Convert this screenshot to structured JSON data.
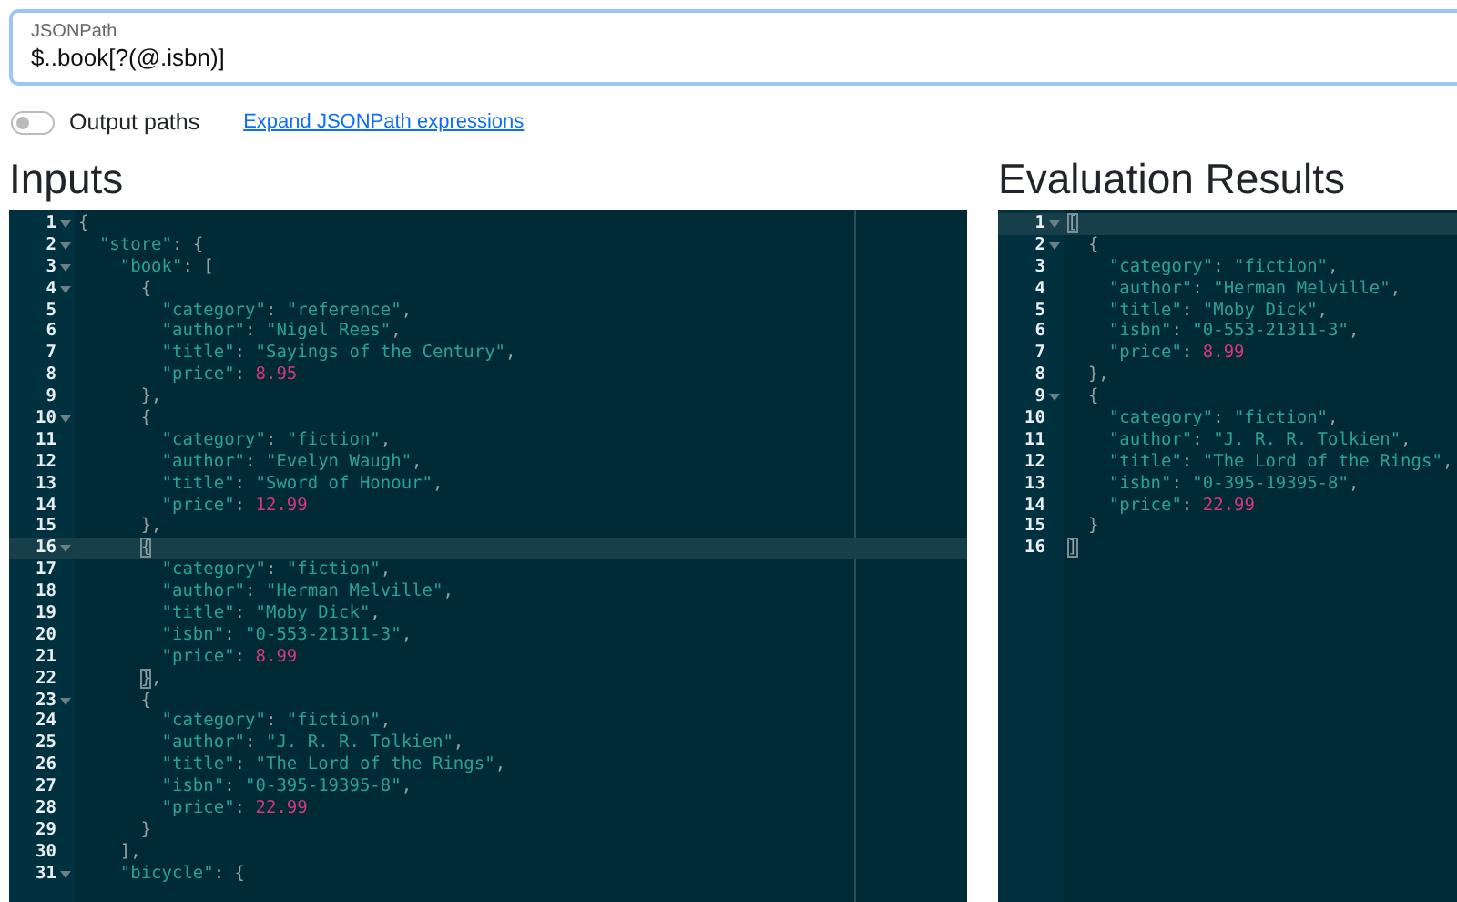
{
  "query": {
    "label": "JSONPath",
    "value": "$..book[?(@.isbn)]"
  },
  "options": {
    "toggle": {
      "label": "Output paths",
      "on": false
    },
    "link": "Expand JSONPath expressions"
  },
  "inputs": {
    "heading": "Inputs",
    "lines": [
      {
        "number": "1",
        "foldable": true,
        "active": false,
        "tokens": [
          {
            "kind": "punct",
            "text": "{"
          }
        ]
      },
      {
        "number": "2",
        "foldable": true,
        "active": false,
        "tokens": [
          {
            "kind": "string",
            "text": "  \"store\""
          },
          {
            "kind": "punct",
            "text": ": {"
          }
        ]
      },
      {
        "number": "3",
        "foldable": true,
        "active": false,
        "tokens": [
          {
            "kind": "string",
            "text": "    \"book\""
          },
          {
            "kind": "punct",
            "text": ": ["
          }
        ]
      },
      {
        "number": "4",
        "foldable": true,
        "active": false,
        "tokens": [
          {
            "kind": "punct",
            "text": "      {"
          }
        ]
      },
      {
        "number": "5",
        "foldable": false,
        "active": false,
        "tokens": [
          {
            "kind": "string",
            "text": "        \"category\""
          },
          {
            "kind": "punct",
            "text": ": "
          },
          {
            "kind": "string",
            "text": "\"reference\""
          },
          {
            "kind": "punct",
            "text": ","
          }
        ]
      },
      {
        "number": "6",
        "foldable": false,
        "active": false,
        "tokens": [
          {
            "kind": "string",
            "text": "        \"author\""
          },
          {
            "kind": "punct",
            "text": ": "
          },
          {
            "kind": "string",
            "text": "\"Nigel Rees\""
          },
          {
            "kind": "punct",
            "text": ","
          }
        ]
      },
      {
        "number": "7",
        "foldable": false,
        "active": false,
        "tokens": [
          {
            "kind": "string",
            "text": "        \"title\""
          },
          {
            "kind": "punct",
            "text": ": "
          },
          {
            "kind": "string",
            "text": "\"Sayings of the Century\""
          },
          {
            "kind": "punct",
            "text": ","
          }
        ]
      },
      {
        "number": "8",
        "foldable": false,
        "active": false,
        "tokens": [
          {
            "kind": "string",
            "text": "        \"price\""
          },
          {
            "kind": "punct",
            "text": ": "
          },
          {
            "kind": "number",
            "text": "8.95"
          }
        ]
      },
      {
        "number": "9",
        "foldable": false,
        "active": false,
        "tokens": [
          {
            "kind": "punct",
            "text": "      },"
          }
        ]
      },
      {
        "number": "10",
        "foldable": true,
        "active": false,
        "tokens": [
          {
            "kind": "punct",
            "text": "      {"
          }
        ]
      },
      {
        "number": "11",
        "foldable": false,
        "active": false,
        "tokens": [
          {
            "kind": "string",
            "text": "        \"category\""
          },
          {
            "kind": "punct",
            "text": ": "
          },
          {
            "kind": "string",
            "text": "\"fiction\""
          },
          {
            "kind": "punct",
            "text": ","
          }
        ]
      },
      {
        "number": "12",
        "foldable": false,
        "active": false,
        "tokens": [
          {
            "kind": "string",
            "text": "        \"author\""
          },
          {
            "kind": "punct",
            "text": ": "
          },
          {
            "kind": "string",
            "text": "\"Evelyn Waugh\""
          },
          {
            "kind": "punct",
            "text": ","
          }
        ]
      },
      {
        "number": "13",
        "foldable": false,
        "active": false,
        "tokens": [
          {
            "kind": "string",
            "text": "        \"title\""
          },
          {
            "kind": "punct",
            "text": ": "
          },
          {
            "kind": "string",
            "text": "\"Sword of Honour\""
          },
          {
            "kind": "punct",
            "text": ","
          }
        ]
      },
      {
        "number": "14",
        "foldable": false,
        "active": false,
        "tokens": [
          {
            "kind": "string",
            "text": "        \"price\""
          },
          {
            "kind": "punct",
            "text": ": "
          },
          {
            "kind": "number",
            "text": "12.99"
          }
        ]
      },
      {
        "number": "15",
        "foldable": false,
        "active": false,
        "tokens": [
          {
            "kind": "punct",
            "text": "      },"
          }
        ]
      },
      {
        "number": "16",
        "foldable": true,
        "active": true,
        "tokens": [
          {
            "kind": "matched",
            "text": "      {"
          }
        ]
      },
      {
        "number": "17",
        "foldable": false,
        "active": false,
        "tokens": [
          {
            "kind": "string",
            "text": "        \"category\""
          },
          {
            "kind": "punct",
            "text": ": "
          },
          {
            "kind": "string",
            "text": "\"fiction\""
          },
          {
            "kind": "punct",
            "text": ","
          }
        ]
      },
      {
        "number": "18",
        "foldable": false,
        "active": false,
        "tokens": [
          {
            "kind": "string",
            "text": "        \"author\""
          },
          {
            "kind": "punct",
            "text": ": "
          },
          {
            "kind": "string",
            "text": "\"Herman Melville\""
          },
          {
            "kind": "punct",
            "text": ","
          }
        ]
      },
      {
        "number": "19",
        "foldable": false,
        "active": false,
        "tokens": [
          {
            "kind": "string",
            "text": "        \"title\""
          },
          {
            "kind": "punct",
            "text": ": "
          },
          {
            "kind": "string",
            "text": "\"Moby Dick\""
          },
          {
            "kind": "punct",
            "text": ","
          }
        ]
      },
      {
        "number": "20",
        "foldable": false,
        "active": false,
        "tokens": [
          {
            "kind": "string",
            "text": "        \"isbn\""
          },
          {
            "kind": "punct",
            "text": ": "
          },
          {
            "kind": "string",
            "text": "\"0-553-21311-3\""
          },
          {
            "kind": "punct",
            "text": ","
          }
        ]
      },
      {
        "number": "21",
        "foldable": false,
        "active": false,
        "tokens": [
          {
            "kind": "string",
            "text": "        \"price\""
          },
          {
            "kind": "punct",
            "text": ": "
          },
          {
            "kind": "number",
            "text": "8.99"
          }
        ]
      },
      {
        "number": "22",
        "foldable": false,
        "active": false,
        "tokens": [
          {
            "kind": "matched",
            "text": "      }"
          },
          {
            "kind": "punct",
            "text": ","
          }
        ]
      },
      {
        "number": "23",
        "foldable": true,
        "active": false,
        "tokens": [
          {
            "kind": "punct",
            "text": "      {"
          }
        ]
      },
      {
        "number": "24",
        "foldable": false,
        "active": false,
        "tokens": [
          {
            "kind": "string",
            "text": "        \"category\""
          },
          {
            "kind": "punct",
            "text": ": "
          },
          {
            "kind": "string",
            "text": "\"fiction\""
          },
          {
            "kind": "punct",
            "text": ","
          }
        ]
      },
      {
        "number": "25",
        "foldable": false,
        "active": false,
        "tokens": [
          {
            "kind": "string",
            "text": "        \"author\""
          },
          {
            "kind": "punct",
            "text": ": "
          },
          {
            "kind": "string",
            "text": "\"J. R. R. Tolkien\""
          },
          {
            "kind": "punct",
            "text": ","
          }
        ]
      },
      {
        "number": "26",
        "foldable": false,
        "active": false,
        "tokens": [
          {
            "kind": "string",
            "text": "        \"title\""
          },
          {
            "kind": "punct",
            "text": ": "
          },
          {
            "kind": "string",
            "text": "\"The Lord of the Rings\""
          },
          {
            "kind": "punct",
            "text": ","
          }
        ]
      },
      {
        "number": "27",
        "foldable": false,
        "active": false,
        "tokens": [
          {
            "kind": "string",
            "text": "        \"isbn\""
          },
          {
            "kind": "punct",
            "text": ": "
          },
          {
            "kind": "string",
            "text": "\"0-395-19395-8\""
          },
          {
            "kind": "punct",
            "text": ","
          }
        ]
      },
      {
        "number": "28",
        "foldable": false,
        "active": false,
        "tokens": [
          {
            "kind": "string",
            "text": "        \"price\""
          },
          {
            "kind": "punct",
            "text": ": "
          },
          {
            "kind": "number",
            "text": "22.99"
          }
        ]
      },
      {
        "number": "29",
        "foldable": false,
        "active": false,
        "tokens": [
          {
            "kind": "punct",
            "text": "      }"
          }
        ]
      },
      {
        "number": "30",
        "foldable": false,
        "active": false,
        "tokens": [
          {
            "kind": "punct",
            "text": "    ],"
          }
        ]
      },
      {
        "number": "31",
        "foldable": true,
        "active": false,
        "tokens": [
          {
            "kind": "string",
            "text": "    \"bicycle\""
          },
          {
            "kind": "punct",
            "text": ": {"
          }
        ]
      }
    ]
  },
  "results": {
    "heading": "Evaluation Results",
    "lines": [
      {
        "number": "1",
        "foldable": true,
        "active": true,
        "tokens": [
          {
            "kind": "matched",
            "text": "["
          }
        ]
      },
      {
        "number": "2",
        "foldable": true,
        "active": false,
        "tokens": [
          {
            "kind": "punct",
            "text": "  {"
          }
        ]
      },
      {
        "number": "3",
        "foldable": false,
        "active": false,
        "tokens": [
          {
            "kind": "string",
            "text": "    \"category\""
          },
          {
            "kind": "punct",
            "text": ": "
          },
          {
            "kind": "string",
            "text": "\"fiction\""
          },
          {
            "kind": "punct",
            "text": ","
          }
        ]
      },
      {
        "number": "4",
        "foldable": false,
        "active": false,
        "tokens": [
          {
            "kind": "string",
            "text": "    \"author\""
          },
          {
            "kind": "punct",
            "text": ": "
          },
          {
            "kind": "string",
            "text": "\"Herman Melville\""
          },
          {
            "kind": "punct",
            "text": ","
          }
        ]
      },
      {
        "number": "5",
        "foldable": false,
        "active": false,
        "tokens": [
          {
            "kind": "string",
            "text": "    \"title\""
          },
          {
            "kind": "punct",
            "text": ": "
          },
          {
            "kind": "string",
            "text": "\"Moby Dick\""
          },
          {
            "kind": "punct",
            "text": ","
          }
        ]
      },
      {
        "number": "6",
        "foldable": false,
        "active": false,
        "tokens": [
          {
            "kind": "string",
            "text": "    \"isbn\""
          },
          {
            "kind": "punct",
            "text": ": "
          },
          {
            "kind": "string",
            "text": "\"0-553-21311-3\""
          },
          {
            "kind": "punct",
            "text": ","
          }
        ]
      },
      {
        "number": "7",
        "foldable": false,
        "active": false,
        "tokens": [
          {
            "kind": "string",
            "text": "    \"price\""
          },
          {
            "kind": "punct",
            "text": ": "
          },
          {
            "kind": "number",
            "text": "8.99"
          }
        ]
      },
      {
        "number": "8",
        "foldable": false,
        "active": false,
        "tokens": [
          {
            "kind": "punct",
            "text": "  },"
          }
        ]
      },
      {
        "number": "9",
        "foldable": true,
        "active": false,
        "tokens": [
          {
            "kind": "punct",
            "text": "  {"
          }
        ]
      },
      {
        "number": "10",
        "foldable": false,
        "active": false,
        "tokens": [
          {
            "kind": "string",
            "text": "    \"category\""
          },
          {
            "kind": "punct",
            "text": ": "
          },
          {
            "kind": "string",
            "text": "\"fiction\""
          },
          {
            "kind": "punct",
            "text": ","
          }
        ]
      },
      {
        "number": "11",
        "foldable": false,
        "active": false,
        "tokens": [
          {
            "kind": "string",
            "text": "    \"author\""
          },
          {
            "kind": "punct",
            "text": ": "
          },
          {
            "kind": "string",
            "text": "\"J. R. R. Tolkien\""
          },
          {
            "kind": "punct",
            "text": ","
          }
        ]
      },
      {
        "number": "12",
        "foldable": false,
        "active": false,
        "tokens": [
          {
            "kind": "string",
            "text": "    \"title\""
          },
          {
            "kind": "punct",
            "text": ": "
          },
          {
            "kind": "string",
            "text": "\"The Lord of the Rings\""
          },
          {
            "kind": "punct",
            "text": ","
          }
        ]
      },
      {
        "number": "13",
        "foldable": false,
        "active": false,
        "tokens": [
          {
            "kind": "string",
            "text": "    \"isbn\""
          },
          {
            "kind": "punct",
            "text": ": "
          },
          {
            "kind": "string",
            "text": "\"0-395-19395-8\""
          },
          {
            "kind": "punct",
            "text": ","
          }
        ]
      },
      {
        "number": "14",
        "foldable": false,
        "active": false,
        "tokens": [
          {
            "kind": "string",
            "text": "    \"price\""
          },
          {
            "kind": "punct",
            "text": ": "
          },
          {
            "kind": "number",
            "text": "22.99"
          }
        ]
      },
      {
        "number": "15",
        "foldable": false,
        "active": false,
        "tokens": [
          {
            "kind": "punct",
            "text": "  }"
          }
        ]
      },
      {
        "number": "16",
        "foldable": false,
        "active": false,
        "tokens": [
          {
            "kind": "matched",
            "text": "]"
          }
        ]
      }
    ]
  }
}
